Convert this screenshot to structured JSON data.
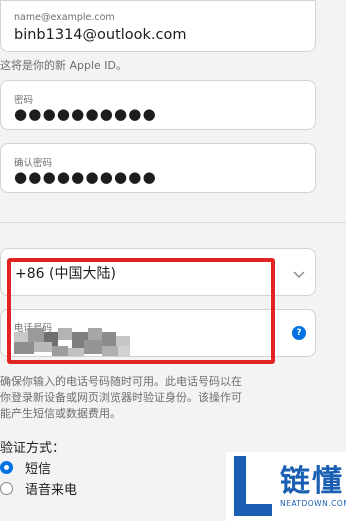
{
  "email": {
    "label": "name@example.com",
    "value": "binb1314@outlook.com",
    "note": "这将是你的新 Apple ID。"
  },
  "password": {
    "label": "密码",
    "masked_value": "●●●●●●●●●●"
  },
  "confirm_password": {
    "label": "确认密码",
    "masked_value": "●●●●●●●●●●"
  },
  "country_code": {
    "selected": "+86 (中国大陆)"
  },
  "phone": {
    "label": "电话号码",
    "help_icon": "?",
    "note_line1": "确保你输入的电话号码随时可用。此电话号码以在",
    "note_line2": "你登录新设备或网页浏览器时验证身份。该操作可",
    "note_line3": "能产生短信或数据费用。"
  },
  "verification": {
    "title": "验证方式：",
    "options": [
      {
        "label": "短信",
        "selected": true
      },
      {
        "label": "语音来电",
        "selected": false
      }
    ]
  },
  "watermark": {
    "text": "链懂",
    "sub": "NEATDOWN.COM"
  },
  "colors": {
    "accent": "#0071e3",
    "highlight_red": "#e02424",
    "watermark_blue": "#1a5fb4"
  }
}
